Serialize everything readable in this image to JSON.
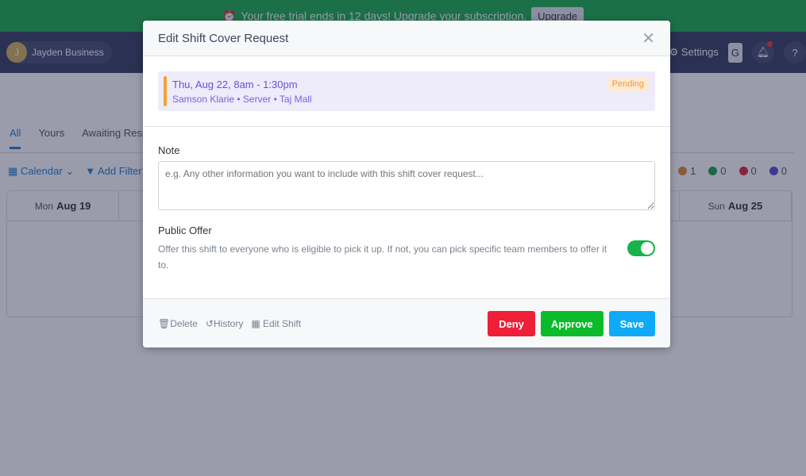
{
  "banner": {
    "text": "Your free trial ends in 12 days! Upgrade your subscription.",
    "upgrade_label": "Upgrade",
    "icon": "alarm-clock-icon"
  },
  "nav": {
    "avatar_initial": "J",
    "business_name": "Jayden Business",
    "settings_label": "Settings",
    "g_label": "G"
  },
  "tabs": [
    {
      "label": "All"
    },
    {
      "label": "Yours"
    },
    {
      "label": "Awaiting Resp"
    }
  ],
  "toolbar": {
    "calendar_label": "Calendar",
    "filter_label": "Add Filter"
  },
  "counts": [
    {
      "value": "1",
      "color": "#e08a2c"
    },
    {
      "value": "0",
      "color": "#16a34a"
    },
    {
      "value": "0",
      "color": "#d9263a"
    },
    {
      "value": "0",
      "color": "#5b4ad6"
    }
  ],
  "calendar": {
    "days": [
      {
        "dow": "Mon",
        "date": "Aug 19"
      },
      {
        "dow": "",
        "date": ""
      },
      {
        "dow": "",
        "date": ""
      },
      {
        "dow": "",
        "date": ""
      },
      {
        "dow": "",
        "date": ""
      },
      {
        "dow": "",
        "date": ""
      },
      {
        "dow": "Sun",
        "date": "Aug 25"
      }
    ]
  },
  "modal": {
    "title": "Edit Shift Cover Request",
    "shift": {
      "time": "Thu, Aug 22, 8am - 1:30pm",
      "details": "Samson Klarie • Server • Taj Mall",
      "status": "Pending"
    },
    "note_label": "Note",
    "note_placeholder": "e.g. Any other information you want to include with this shift cover request...",
    "public_offer_label": "Public Offer",
    "public_offer_desc": "Offer this shift to everyone who is eligible to pick it up. If not, you can pick specific team members to offer it to.",
    "public_offer_enabled": true,
    "footer": {
      "delete": "Delete",
      "history": "History",
      "edit_shift": "Edit Shift",
      "deny": "Deny",
      "approve": "Approve",
      "save": "Save"
    },
    "colors": {
      "deny": "#ee1f37",
      "approve": "#0bbb2a",
      "save": "#0faaf7"
    }
  }
}
